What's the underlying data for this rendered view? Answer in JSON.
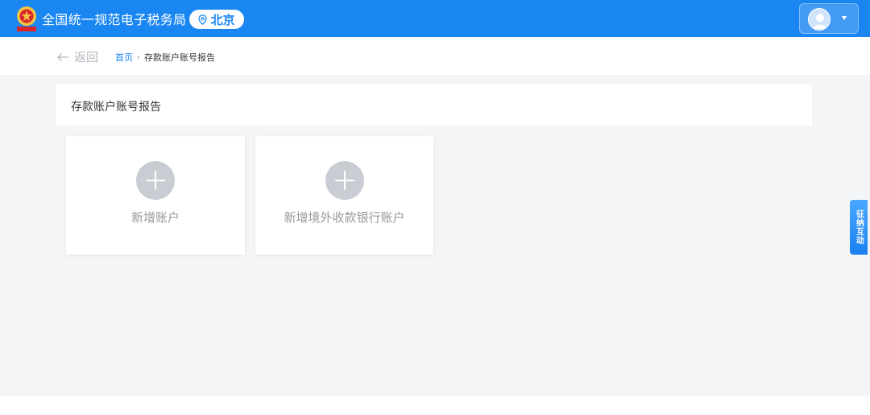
{
  "header": {
    "brand": "全国统一规范电子税务局",
    "location": "北京",
    "emblem_icon": "tax-emblem-icon",
    "location_icon": "location-pin-icon",
    "user_icon": "user-avatar-icon",
    "accent_color": "#1a86f2"
  },
  "nav": {
    "back_label": "返回",
    "breadcrumb": {
      "home": "首页",
      "separator": "›",
      "current": "存款账户账号报告"
    }
  },
  "page": {
    "title": "存款账户账号报告"
  },
  "cards": [
    {
      "label": "新增账户",
      "icon": "plus-circle-icon"
    },
    {
      "label": "新增境外收款银行账户",
      "icon": "plus-circle-icon"
    }
  ],
  "side_tab": {
    "label": "征纳互动"
  }
}
